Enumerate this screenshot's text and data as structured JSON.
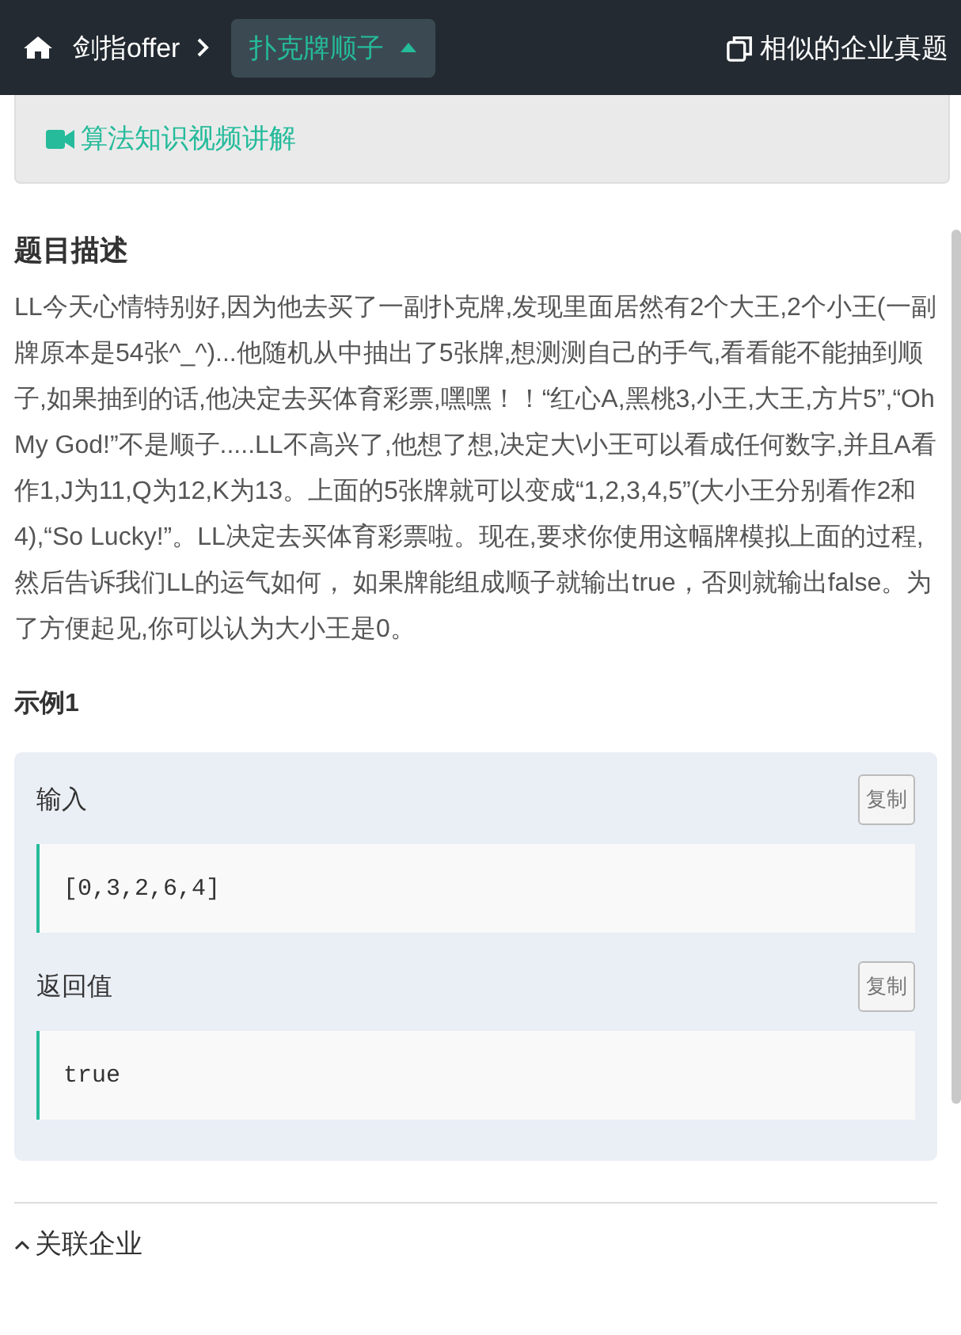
{
  "header": {
    "home": "剑指offer",
    "current": {
      "label": "扑克牌顺子",
      "expanded": true
    },
    "similar": "相似的企业真题"
  },
  "video_link": "算法知识视频讲解",
  "description": {
    "title": "题目描述",
    "text": "LL今天心情特别好,因为他去买了一副扑克牌,发现里面居然有2个大王,2个小王(一副牌原本是54张^_^)...他随机从中抽出了5张牌,想测测自己的手气,看看能不能抽到顺子,如果抽到的话,他决定去买体育彩票,嘿嘿！！“红心A,黑桃3,小王,大王,方片5”,“Oh My God!”不是顺子.....LL不高兴了,他想了想,决定大\\小王可以看成任何数字,并且A看作1,J为11,Q为12,K为13。上面的5张牌就可以变成“1,2,3,4,5”(大小王分别看作2和4),“So Lucky!”。LL决定去买体育彩票啦。现在,要求你使用这幅牌模拟上面的过程,然后告诉我们LL的运气如何， 如果牌能组成顺子就输出true，否则就输出false。为了方便起见,你可以认为大小王是0。"
  },
  "example": {
    "title": "示例1",
    "blocks": [
      {
        "label": "输入",
        "copy": "复制",
        "code": "[0,3,2,6,4]"
      },
      {
        "label": "返回值",
        "copy": "复制",
        "code": "true"
      }
    ]
  },
  "related": "关联企业"
}
